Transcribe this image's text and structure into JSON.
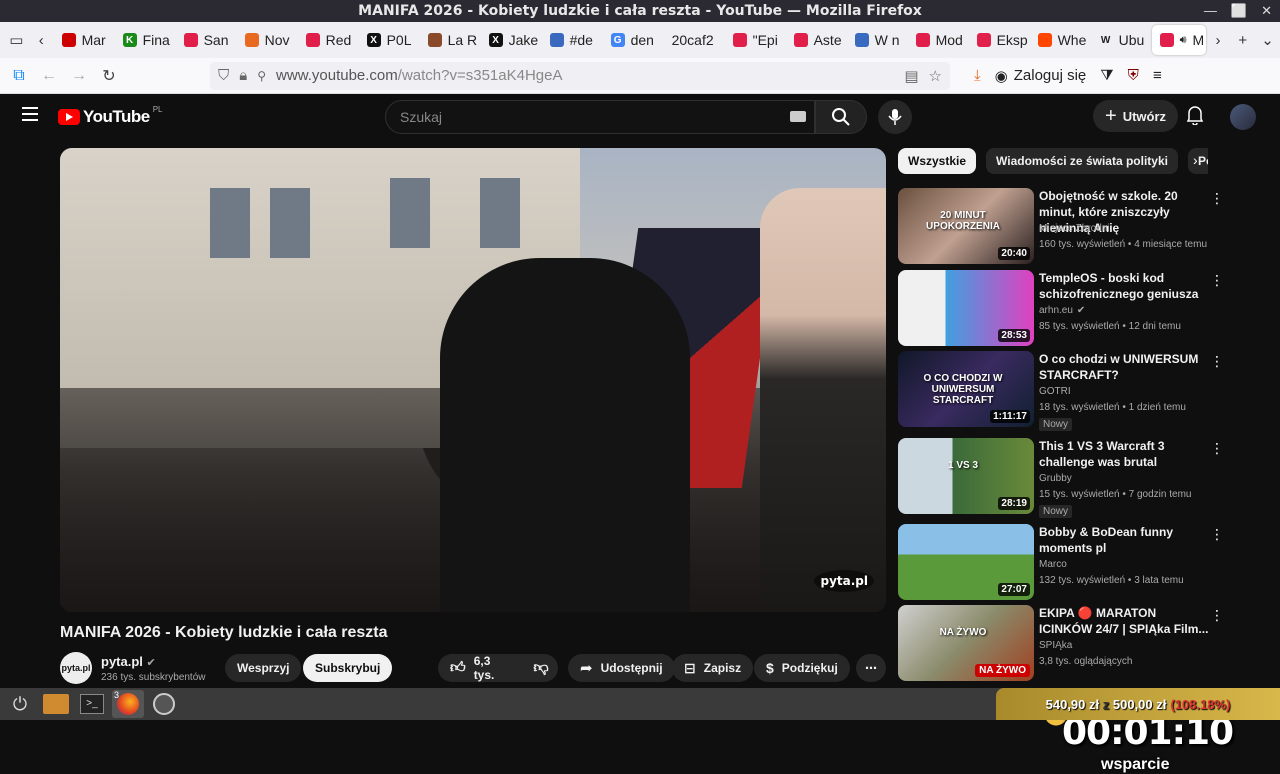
{
  "window": {
    "title": "MANIFA 2026 - Kobiety ludzkie i cała reszta - YouTube — Mozilla Firefox"
  },
  "tabs": [
    {
      "label": "Mar",
      "fav_color": "#cc0000",
      "fav_text": ""
    },
    {
      "label": "Fina",
      "fav_color": "#1a8a1a",
      "fav_text": "K"
    },
    {
      "label": "San",
      "fav_color": "#e0204a",
      "fav_text": ""
    },
    {
      "label": "Nov",
      "fav_color": "#e86a20",
      "fav_text": ""
    },
    {
      "label": "Red",
      "fav_color": "#e0204a",
      "fav_text": ""
    },
    {
      "label": "P0L",
      "fav_color": "#111111",
      "fav_text": "X"
    },
    {
      "label": "La R",
      "fav_color": "#8a4a2a",
      "fav_text": ""
    },
    {
      "label": "Jake",
      "fav_color": "#111111",
      "fav_text": "X"
    },
    {
      "label": "#de",
      "fav_color": "#3a6ac0",
      "fav_text": ""
    },
    {
      "label": "den",
      "fav_color": "#4285f4",
      "fav_text": "G"
    },
    {
      "label": "20caf2",
      "fav_color": "",
      "fav_text": ""
    },
    {
      "label": "\"Epi",
      "fav_color": "#e0204a",
      "fav_text": ""
    },
    {
      "label": "Aste",
      "fav_color": "#e0204a",
      "fav_text": ""
    },
    {
      "label": "W n",
      "fav_color": "#3a6ac0",
      "fav_text": ""
    },
    {
      "label": "Mod",
      "fav_color": "#e0204a",
      "fav_text": ""
    },
    {
      "label": "Eksp",
      "fav_color": "#e0204a",
      "fav_text": ""
    },
    {
      "label": "Whe",
      "fav_color": "#ff4500",
      "fav_text": ""
    },
    {
      "label": "Ubu",
      "fav_color": "",
      "fav_text": "W"
    },
    {
      "label": "M",
      "fav_color": "#e0204a",
      "fav_text": "",
      "active": true
    }
  ],
  "navbar": {
    "url_prefix": "www.youtube.com",
    "url_rest": "/watch?v=s351aK4HgeA",
    "login_label": "Zaloguj się"
  },
  "youtube": {
    "logo_text": "YouTube",
    "country": "PL",
    "search_placeholder": "Szukaj",
    "create_label": "Utwórz",
    "video_title": "MANIFA 2026 - Kobiety ludzkie i cała reszta",
    "watermark": "pyta.pl",
    "channel": {
      "name": "pyta.pl",
      "subs": "236 tys. subskrybentów",
      "avatar_text": "pyta.pl"
    },
    "actions": {
      "support": "Wesprzyj",
      "subscribe": "Subskrybuj",
      "likes": "6,3 tys.",
      "share": "Udostępnij",
      "save": "Zapisz",
      "thanks": "Podziękuj"
    },
    "chips": [
      "Wszystkie",
      "Wiadomości ze świata polityki",
      "Pod"
    ],
    "recs": [
      {
        "title": "Obojętność w szkole. 20 minut, które zniszczyły niewinną Anię",
        "channel": "Miejsce Zbrodni",
        "meta": "160 tys. wyświetleń • 4 miesiące temu",
        "duration": "20:40",
        "badge": "",
        "thumb_text": "20 MINUT UPOKORZENIA"
      },
      {
        "title": "TempleOS - boski kod schizofrenicznego geniusza",
        "channel": "arhn.eu",
        "verified": true,
        "meta": "85 tys. wyświetleń • 12 dni temu",
        "duration": "28:53",
        "badge": "",
        "thumb_text": ""
      },
      {
        "title": "O co chodzi w UNIWERSUM STARCRAFT?",
        "channel": "GOTRI",
        "meta": "18 tys. wyświetleń • 1 dzień temu",
        "duration": "1:11:17",
        "badge": "Nowy",
        "thumb_text": "O CO CHODZI W UNIWERSUM STARCRAFT"
      },
      {
        "title": "This 1 VS 3 Warcraft 3 challenge was brutal",
        "channel": "Grubby",
        "meta": "15 tys. wyświetleń • 7 godzin temu",
        "duration": "28:19",
        "badge": "Nowy",
        "thumb_text": "1 VS 3"
      },
      {
        "title": "Bobby & BoDean funny moments pl",
        "channel": "Marco",
        "meta": "132 tys. wyświetleń • 3 lata temu",
        "duration": "27:07",
        "badge": "",
        "thumb_text": ""
      },
      {
        "title": "EKIPA 🔴 MARATON ICINKÓW 24/7 | SPIĄka Film...",
        "channel": "SPIĄka",
        "meta": "3,8 tys. oglądających",
        "duration": "",
        "live": "NA ŻYWO",
        "badge": "",
        "thumb_text": "NA ŻYWO"
      }
    ]
  },
  "overlay": {
    "timer": "00:01:10",
    "support_label": "wsparcie",
    "goal_current": "540,90 zł",
    "goal_sep": "z",
    "goal_target": "500,00 zł",
    "goal_percent": "(108.18%)"
  },
  "taskbar": {
    "firefox_count": "3"
  },
  "colors": {
    "yt_bg": "#0f0f0f",
    "yt_red": "#ff0000",
    "chip_bg": "#272727",
    "goal_gold": "#d8b84a"
  }
}
